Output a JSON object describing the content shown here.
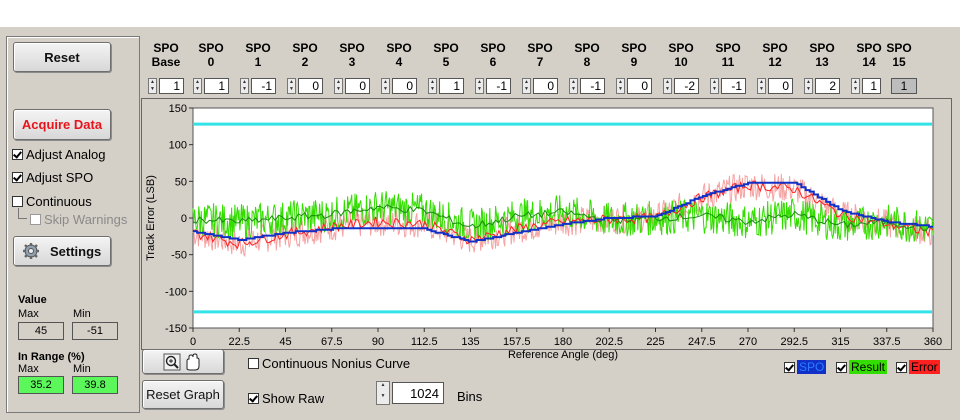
{
  "controls": {
    "reset": "Reset",
    "acquire": "Acquire Data",
    "adjust_analog": "Adjust Analog",
    "adjust_spo": "Adjust SPO",
    "continuous": "Continuous",
    "skip_warnings": "Skip Warnings",
    "settings": "Settings"
  },
  "stats": {
    "value_label": "Value",
    "max_label": "Max",
    "min_label": "Min",
    "value_max": "45",
    "value_min": "-51",
    "inrange_label": "In Range (%)",
    "inrange_max": "35.2",
    "inrange_min": "39.8"
  },
  "spo": [
    {
      "h1": "SPO",
      "h2": "Base",
      "v": "1"
    },
    {
      "h1": "SPO",
      "h2": "0",
      "v": "1"
    },
    {
      "h1": "SPO",
      "h2": "1",
      "v": "-1"
    },
    {
      "h1": "SPO",
      "h2": "2",
      "v": "0"
    },
    {
      "h1": "SPO",
      "h2": "3",
      "v": "0"
    },
    {
      "h1": "SPO",
      "h2": "4",
      "v": "0"
    },
    {
      "h1": "SPO",
      "h2": "5",
      "v": "1"
    },
    {
      "h1": "SPO",
      "h2": "6",
      "v": "-1"
    },
    {
      "h1": "SPO",
      "h2": "7",
      "v": "0"
    },
    {
      "h1": "SPO",
      "h2": "8",
      "v": "-1"
    },
    {
      "h1": "SPO",
      "h2": "9",
      "v": "0"
    },
    {
      "h1": "SPO",
      "h2": "10",
      "v": "-2"
    },
    {
      "h1": "SPO",
      "h2": "11",
      "v": "-1"
    },
    {
      "h1": "SPO",
      "h2": "12",
      "v": "0"
    },
    {
      "h1": "SPO",
      "h2": "13",
      "v": "2"
    },
    {
      "h1": "SPO",
      "h2": "14",
      "v": "1"
    },
    {
      "h1": "SPO",
      "h2": "15",
      "v": "1"
    }
  ],
  "graph": {
    "continuous_nonius": "Continuous Nonius Curve",
    "reset_graph": "Reset Graph",
    "show_raw": "Show Raw",
    "bins_value": "1024",
    "bins_label": "Bins"
  },
  "chart_data": {
    "type": "line",
    "xlabel": "Reference Angle (deg)",
    "ylabel": "Track Error (LSB)",
    "xlim": [
      0,
      360
    ],
    "ylim": [
      -150,
      150
    ],
    "xticks": [
      "0",
      "22.5",
      "45",
      "67.5",
      "90",
      "112.5",
      "135",
      "157.5",
      "180",
      "202.5",
      "225",
      "247.5",
      "270",
      "292.5",
      "315",
      "337.5",
      "360"
    ],
    "yticks": [
      "150",
      "100",
      "50",
      "0",
      "-50",
      "-100",
      "-150"
    ],
    "limits": [
      128,
      -128
    ],
    "colors": {
      "spo": "#1030c8",
      "result": "#33dd00",
      "error": "#ff2020",
      "error_raw": "#f5a3a3",
      "limit": "#33e3e8"
    },
    "legend": [
      "SPO",
      "Result",
      "Error"
    ],
    "series": [
      {
        "name": "SPO",
        "x": [
          0,
          22.5,
          45,
          67.5,
          90,
          112.5,
          135,
          157.5,
          180,
          202.5,
          225,
          247.5,
          270,
          292.5,
          315,
          337.5,
          360
        ],
        "values": [
          -18,
          -30,
          -20,
          -15,
          -15,
          -15,
          -32,
          -20,
          -8,
          0,
          2,
          30,
          48,
          48,
          10,
          -5,
          -12
        ]
      },
      {
        "name": "Result",
        "x": [
          0,
          22.5,
          45,
          67.5,
          90,
          112.5,
          135,
          157.5,
          180,
          202.5,
          225,
          247.5,
          270,
          292.5,
          315,
          337.5,
          360
        ],
        "values": [
          -2,
          -5,
          0,
          5,
          15,
          10,
          -12,
          2,
          8,
          -3,
          0,
          3,
          -5,
          5,
          -10,
          -5,
          -15
        ]
      },
      {
        "name": "Error",
        "x": [
          0,
          22.5,
          45,
          67.5,
          90,
          112.5,
          135,
          157.5,
          180,
          202.5,
          225,
          247.5,
          270,
          292.5,
          315,
          337.5,
          360
        ],
        "values": [
          -20,
          -35,
          -22,
          -12,
          -5,
          -8,
          -30,
          -15,
          -5,
          -2,
          0,
          28,
          45,
          40,
          5,
          -8,
          -20
        ]
      }
    ]
  }
}
